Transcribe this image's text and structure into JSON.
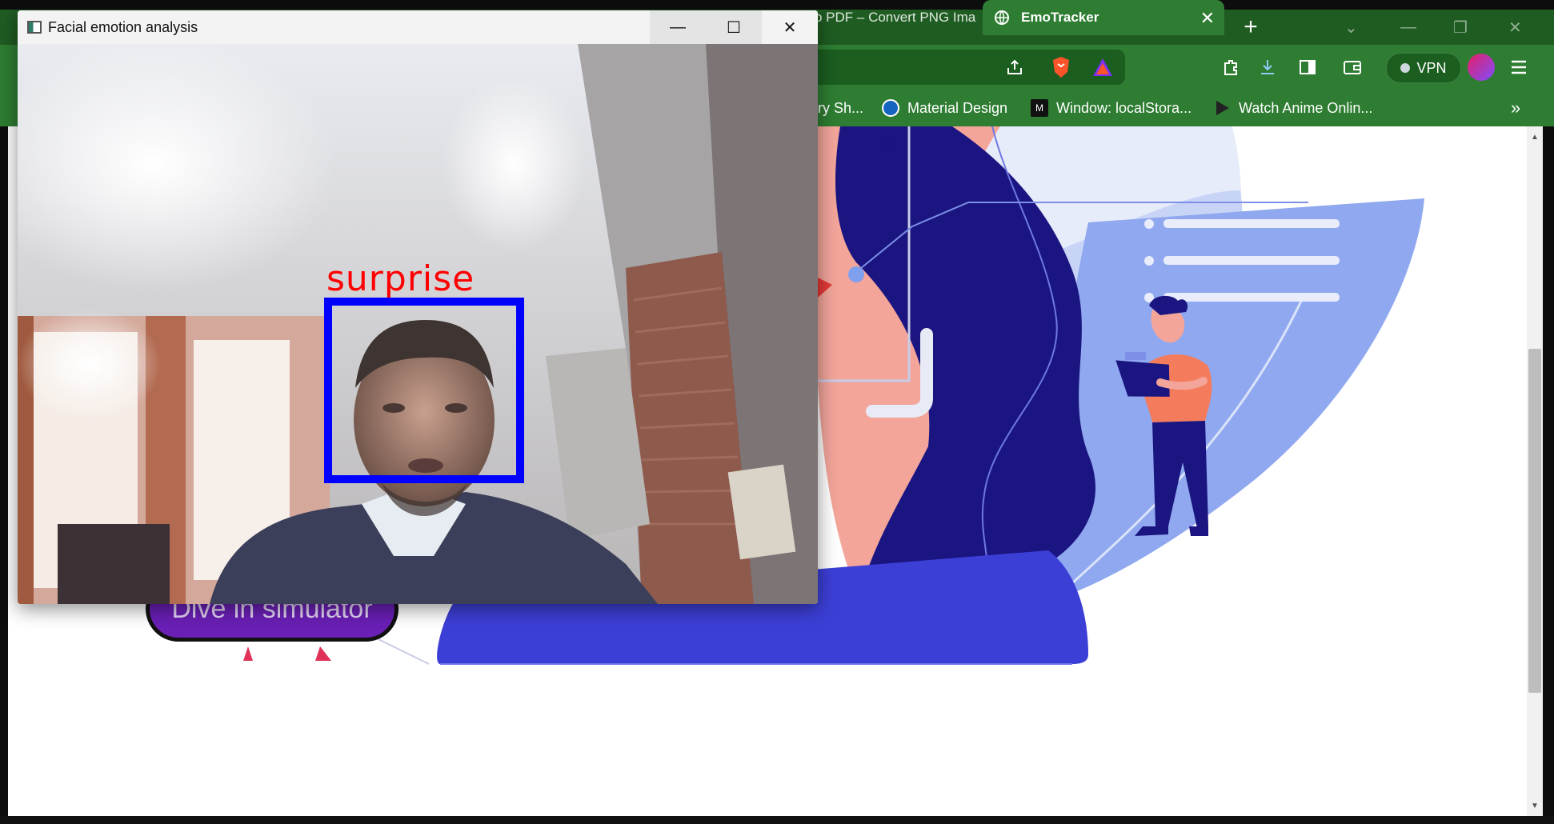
{
  "browser": {
    "tabs": [
      {
        "label": "o PDF – Convert PNG Ima",
        "active": false
      },
      {
        "label": "EmoTracker",
        "active": true
      }
    ],
    "new_tab_symbol": "+",
    "toolbar_icons": [
      "share-icon",
      "brave-shield-icon",
      "brave-rewards-icon",
      "extensions-icon",
      "download-icon",
      "sidebar-icon",
      "wallet-icon",
      "menu-icon"
    ],
    "vpn_label": "VPN",
    "bookmarks": [
      {
        "label": "ry Sh...",
        "icon": "bookmark-icon"
      },
      {
        "label": "Material Design",
        "icon": "material-icon"
      },
      {
        "label": "Window: localStora...",
        "icon": "mdn-icon"
      },
      {
        "label": "Watch Anime Onlin...",
        "icon": "play-icon"
      }
    ],
    "bookmarks_overflow": "»",
    "colors": {
      "chrome": "#2e7d32",
      "tabstrip": "#1f5c22"
    }
  },
  "page": {
    "cta_label": "Dive in simulator",
    "colors": {
      "primary": "#3c3fd6",
      "cta": "#6a1fb5"
    }
  },
  "app_window": {
    "title": "Facial emotion analysis",
    "controls": {
      "minimize": "—",
      "maximize": "☐",
      "close": "✕"
    },
    "detection": {
      "label": "surprise",
      "box_color": "#0000ff",
      "label_color": "#ff0000"
    }
  }
}
